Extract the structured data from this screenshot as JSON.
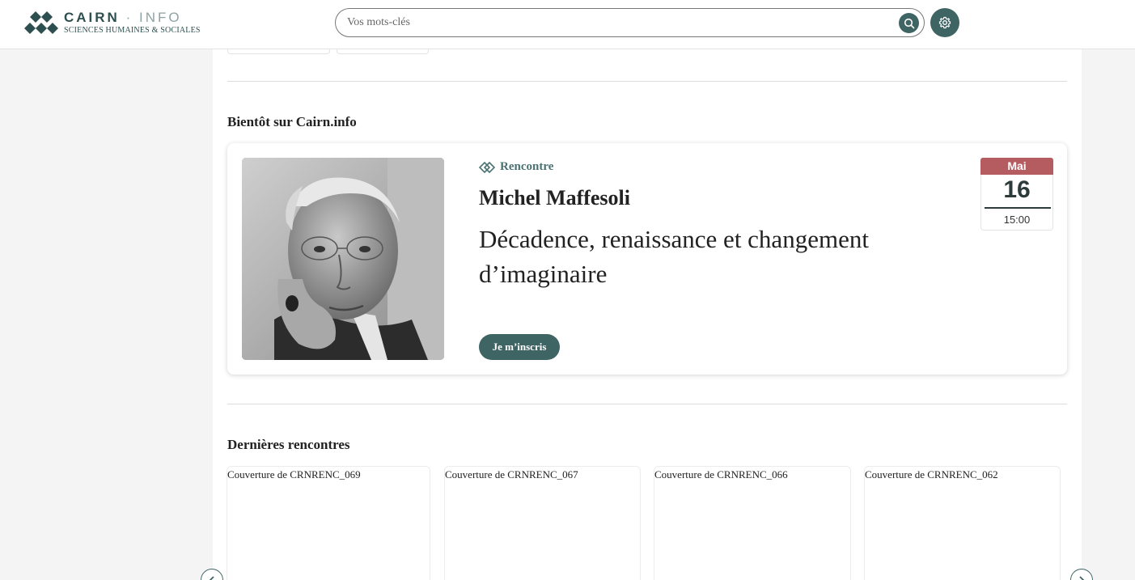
{
  "brand": {
    "name_main": "CAIRN",
    "name_dot": "·",
    "name_suffix": "INFO",
    "subtitle": "SCIENCES HUMAINES & SOCIALES"
  },
  "search": {
    "placeholder": "Vos mots-clés",
    "value": ""
  },
  "colors": {
    "accent": "#3f6464",
    "date_month_bg": "#b55c60",
    "background": "#f4f4f4"
  },
  "upcoming": {
    "section_title": "Bientôt sur Cairn.info",
    "event": {
      "type_label": "Rencontre",
      "speaker": "Michel Maffesoli",
      "title": "Décadence, renaissance et changement d’imaginaire",
      "register_label": "Je m’inscris",
      "date": {
        "month": "Mai",
        "day": "16",
        "time": "15:00"
      }
    }
  },
  "recent": {
    "section_title": "Dernières rencontres",
    "items": [
      {
        "label": "Couverture de CRNRENC_069"
      },
      {
        "label": "Couverture de CRNRENC_067"
      },
      {
        "label": "Couverture de CRNRENC_066"
      },
      {
        "label": "Couverture de CRNRENC_062"
      }
    ]
  },
  "icons": {
    "search": "search-icon",
    "settings": "gear-icon",
    "event_type": "diamond-icon",
    "prev": "chevron-left-icon",
    "next": "chevron-right-icon"
  }
}
